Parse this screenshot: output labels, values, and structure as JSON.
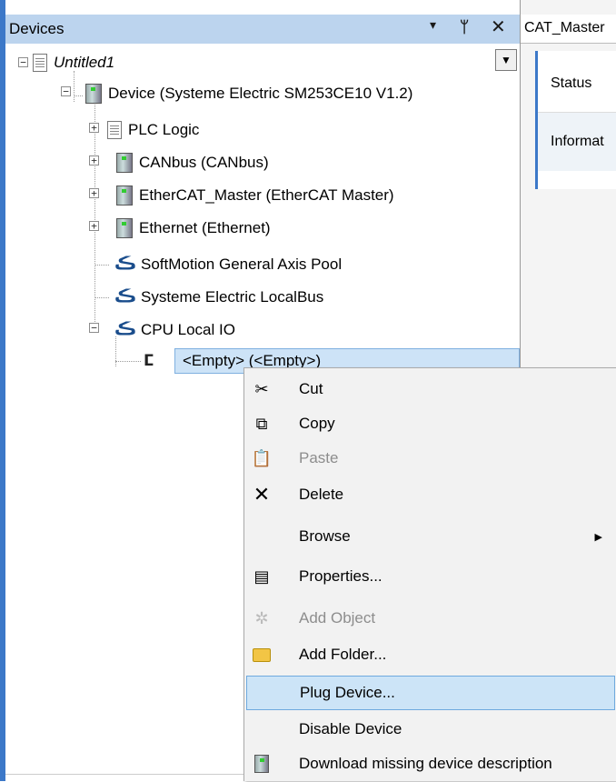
{
  "devices_panel": {
    "title": "Devices",
    "dock_down": "▾",
    "dock_pin": "ᛘ",
    "dock_close": "✕",
    "combo_arrow": "▼"
  },
  "tree": {
    "root": "Untitled1",
    "device": "Device (Systeme Electric SM253CE10 V1.2)",
    "plc_logic": "PLC Logic",
    "canbus": "CANbus (CANbus)",
    "ethercat": "EtherCAT_Master (EtherCAT Master)",
    "ethernet": "Ethernet (Ethernet)",
    "softmotion": "SoftMotion General Axis Pool",
    "localbus": "Systeme Electric LocalBus",
    "cpu_local_io": "CPU Local IO",
    "empty_slot": "<Empty> (<Empty>)"
  },
  "editor": {
    "tab_label": "CAT_Master",
    "side_tabs": [
      "Status",
      "Informat"
    ]
  },
  "context_menu": {
    "items": [
      {
        "label": "Cut",
        "icon": "scissors-icon",
        "enabled": true
      },
      {
        "label": "Copy",
        "icon": "copy-icon",
        "enabled": true
      },
      {
        "label": "Paste",
        "icon": "paste-icon",
        "enabled": false
      },
      {
        "label": "Delete",
        "icon": "delete-icon",
        "enabled": true
      },
      {
        "label": "Browse",
        "icon": "",
        "enabled": true,
        "submenu": true
      },
      {
        "label": "Properties...",
        "icon": "properties-icon",
        "enabled": true
      },
      {
        "label": "Add Object",
        "icon": "add-object-icon",
        "enabled": false
      },
      {
        "label": "Add Folder...",
        "icon": "folder-icon",
        "enabled": true
      },
      {
        "label": "Plug Device...",
        "icon": "",
        "enabled": true,
        "highlighted": true
      },
      {
        "label": "Disable Device",
        "icon": "",
        "enabled": true
      },
      {
        "label": "Download missing device description",
        "icon": "device-icon",
        "enabled": true
      }
    ]
  },
  "colors": {
    "accent": "#3c78c8",
    "header_bg": "#bcd4ee",
    "selection_bg": "#cde3f7",
    "menu_bg": "#f2f2f2",
    "menu_hover": "#cce4f7"
  }
}
